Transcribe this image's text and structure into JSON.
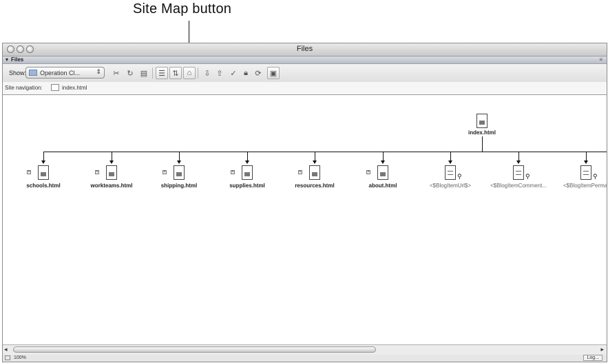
{
  "callout": {
    "text": "Site Map button"
  },
  "window": {
    "title": "Files"
  },
  "panel": {
    "header": "Files"
  },
  "toolbar": {
    "show_label": "Show:",
    "site_value": "Operation Cl...",
    "buttons": [
      "connect",
      "refresh",
      "view-site-ftp-log",
      "files-view",
      "testing-server",
      "site-map",
      "get",
      "put",
      "check-out",
      "check-in",
      "synchronize",
      "expand-collapse"
    ]
  },
  "site_navigation": {
    "label": "Site navigation:",
    "file": "index.html"
  },
  "sitemap": {
    "root": "index.html",
    "children": [
      {
        "label": "schools.html",
        "kind": "page",
        "expandable": true
      },
      {
        "label": "workteams.html",
        "kind": "page",
        "expandable": true
      },
      {
        "label": "shipping.html",
        "kind": "page",
        "expandable": true
      },
      {
        "label": "supplies.html",
        "kind": "page",
        "expandable": true
      },
      {
        "label": "resources.html",
        "kind": "page",
        "expandable": true
      },
      {
        "label": "about.html",
        "kind": "page",
        "expandable": true
      },
      {
        "label": "<$BlogItemUrl$>",
        "kind": "dynamic",
        "expandable": false
      },
      {
        "label": "<$BlogItemComment...",
        "kind": "dynamic",
        "expandable": false
      },
      {
        "label": "<$BlogItemPermal",
        "kind": "dynamic",
        "expandable": false
      }
    ]
  },
  "status": {
    "zoom": "100%",
    "log": "Log..."
  }
}
